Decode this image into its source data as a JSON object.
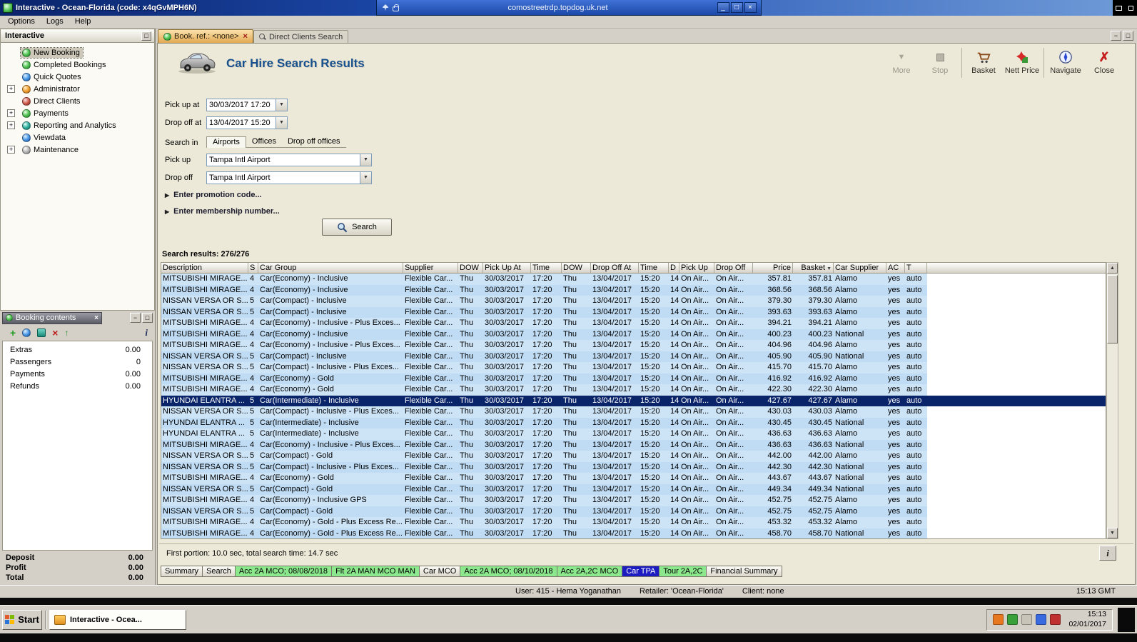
{
  "rdp": {
    "address": "comostreetrdp.topdog.uk.net"
  },
  "window": {
    "title": "Interactive - Ocean-Florida (code: x4qGvMPH6N)",
    "menu": [
      "Options",
      "Logs",
      "Help"
    ]
  },
  "sidebar": {
    "title": "Interactive",
    "items": [
      {
        "label": "New Booking",
        "selected": true
      },
      {
        "label": "Completed Bookings"
      },
      {
        "label": "Quick Quotes"
      },
      {
        "label": "Administrator",
        "expandable": true
      },
      {
        "label": "Direct Clients"
      },
      {
        "label": "Payments",
        "expandable": true
      },
      {
        "label": "Reporting and Analytics",
        "expandable": true
      },
      {
        "label": "Viewdata"
      },
      {
        "label": "Maintenance",
        "expandable": true
      }
    ]
  },
  "booking": {
    "title": "Booking contents",
    "rows": [
      {
        "label": "Extras",
        "value": "0.00"
      },
      {
        "label": "Passengers",
        "value": "0"
      },
      {
        "label": "Payments",
        "value": "0.00"
      },
      {
        "label": "Refunds",
        "value": "0.00"
      }
    ],
    "summary": [
      {
        "label": "Deposit",
        "value": "0.00"
      },
      {
        "label": "Profit",
        "value": "0.00"
      },
      {
        "label": "Total",
        "value": "0.00"
      }
    ]
  },
  "doc_tabs": [
    {
      "label": "Book. ref.: <none>",
      "active": true
    },
    {
      "label": "Direct Clients Search",
      "active": false
    }
  ],
  "page": {
    "title": "Car Hire Search Results"
  },
  "toolbar": {
    "items": [
      {
        "label": "More",
        "disabled": true
      },
      {
        "label": "Stop",
        "disabled": true
      },
      {
        "label": "Basket"
      },
      {
        "label": "Nett Price"
      },
      {
        "label": "Navigate"
      },
      {
        "label": "Close"
      }
    ]
  },
  "form": {
    "pickup_at": {
      "label": "Pick up at",
      "value": "30/03/2017 17:20"
    },
    "dropoff_at": {
      "label": "Drop off at",
      "value": "13/04/2017 15:20"
    },
    "search_in": {
      "label": "Search in",
      "tabs": [
        "Airports",
        "Offices",
        "Drop off offices"
      ],
      "active": "Airports"
    },
    "pickup": {
      "label": "Pick up",
      "value": "Tampa Intl Airport"
    },
    "dropoff": {
      "label": "Drop off",
      "value": "Tampa Intl Airport"
    },
    "promotion": "Enter promotion code...",
    "membership": "Enter membership number...",
    "search_button": "Search"
  },
  "results": {
    "count_label": "Search results: 276/276",
    "columns": [
      "Description",
      "S",
      "Car Group",
      "Supplier",
      "DOW",
      "Pick Up At",
      "Time",
      "DOW",
      "Drop Off At",
      "Time",
      "D",
      "Pick Up",
      "Drop Off",
      "Price",
      "Basket",
      "Car Supplier",
      "AC",
      "T"
    ],
    "selected_index": 11,
    "common": {
      "supplier": "Flexible Car...",
      "dow1": "Thu",
      "pickup_date": "30/03/2017",
      "pickup_time": "17:20",
      "dow2": "Thu",
      "dropoff_date": "13/04/2017",
      "dropoff_time": "15:20",
      "days": "14",
      "pickup_loc": "On Air...",
      "dropoff_loc": "On Air...",
      "ac": "yes",
      "t": "auto"
    },
    "rows": [
      {
        "description": "MITSUBISHI MIRAGE...",
        "seats": "4",
        "group": "Car(Economy) - Inclusive",
        "price": "357.81",
        "basket": "357.81",
        "car_supplier": "Alamo"
      },
      {
        "description": "MITSUBISHI MIRAGE...",
        "seats": "4",
        "group": "Car(Economy) - Inclusive",
        "price": "368.56",
        "basket": "368.56",
        "car_supplier": "Alamo"
      },
      {
        "description": "NISSAN VERSA OR S...",
        "seats": "5",
        "group": "Car(Compact) - Inclusive",
        "price": "379.30",
        "basket": "379.30",
        "car_supplier": "Alamo"
      },
      {
        "description": "NISSAN VERSA OR S...",
        "seats": "5",
        "group": "Car(Compact) - Inclusive",
        "price": "393.63",
        "basket": "393.63",
        "car_supplier": "Alamo"
      },
      {
        "description": "MITSUBISHI MIRAGE...",
        "seats": "4",
        "group": "Car(Economy) - Inclusive - Plus Exces...",
        "price": "394.21",
        "basket": "394.21",
        "car_supplier": "Alamo"
      },
      {
        "description": "MITSUBISHI MIRAGE...",
        "seats": "4",
        "group": "Car(Economy) - Inclusive",
        "price": "400.23",
        "basket": "400.23",
        "car_supplier": "National"
      },
      {
        "description": "MITSUBISHI MIRAGE...",
        "seats": "4",
        "group": "Car(Economy) - Inclusive - Plus Exces...",
        "price": "404.96",
        "basket": "404.96",
        "car_supplier": "Alamo"
      },
      {
        "description": "NISSAN VERSA OR S...",
        "seats": "5",
        "group": "Car(Compact) - Inclusive",
        "price": "405.90",
        "basket": "405.90",
        "car_supplier": "National"
      },
      {
        "description": "NISSAN VERSA OR S...",
        "seats": "5",
        "group": "Car(Compact) - Inclusive - Plus Exces...",
        "price": "415.70",
        "basket": "415.70",
        "car_supplier": "Alamo"
      },
      {
        "description": "MITSUBISHI MIRAGE...",
        "seats": "4",
        "group": "Car(Economy) - Gold",
        "price": "416.92",
        "basket": "416.92",
        "car_supplier": "Alamo"
      },
      {
        "description": "MITSUBISHI MIRAGE...",
        "seats": "4",
        "group": "Car(Economy) - Gold",
        "price": "422.30",
        "basket": "422.30",
        "car_supplier": "Alamo"
      },
      {
        "description": "HYUNDAI ELANTRA ...",
        "seats": "5",
        "group": "Car(Intermediate) - Inclusive",
        "price": "427.67",
        "basket": "427.67",
        "car_supplier": "Alamo"
      },
      {
        "description": "NISSAN VERSA OR S...",
        "seats": "5",
        "group": "Car(Compact) - Inclusive - Plus Exces...",
        "price": "430.03",
        "basket": "430.03",
        "car_supplier": "Alamo"
      },
      {
        "description": "HYUNDAI ELANTRA ...",
        "seats": "5",
        "group": "Car(Intermediate) - Inclusive",
        "price": "430.45",
        "basket": "430.45",
        "car_supplier": "National"
      },
      {
        "description": "HYUNDAI ELANTRA ...",
        "seats": "5",
        "group": "Car(Intermediate) - Inclusive",
        "price": "436.63",
        "basket": "436.63",
        "car_supplier": "Alamo"
      },
      {
        "description": "MITSUBISHI MIRAGE...",
        "seats": "4",
        "group": "Car(Economy) - Inclusive - Plus Exces...",
        "price": "436.63",
        "basket": "436.63",
        "car_supplier": "National"
      },
      {
        "description": "NISSAN VERSA OR S...",
        "seats": "5",
        "group": "Car(Compact) - Gold",
        "price": "442.00",
        "basket": "442.00",
        "car_supplier": "Alamo"
      },
      {
        "description": "NISSAN VERSA OR S...",
        "seats": "5",
        "group": "Car(Compact) - Inclusive - Plus Exces...",
        "price": "442.30",
        "basket": "442.30",
        "car_supplier": "National"
      },
      {
        "description": "MITSUBISHI MIRAGE...",
        "seats": "4",
        "group": "Car(Economy) - Gold",
        "price": "443.67",
        "basket": "443.67",
        "car_supplier": "National"
      },
      {
        "description": "NISSAN VERSA OR S...",
        "seats": "5",
        "group": "Car(Compact) - Gold",
        "price": "449.34",
        "basket": "449.34",
        "car_supplier": "National"
      },
      {
        "description": "MITSUBISHI MIRAGE...",
        "seats": "4",
        "group": "Car(Economy) - Inclusive GPS",
        "price": "452.75",
        "basket": "452.75",
        "car_supplier": "Alamo"
      },
      {
        "description": "NISSAN VERSA OR S...",
        "seats": "5",
        "group": "Car(Compact) - Gold",
        "price": "452.75",
        "basket": "452.75",
        "car_supplier": "Alamo"
      },
      {
        "description": "MITSUBISHI MIRAGE...",
        "seats": "4",
        "group": "Car(Economy) - Gold - Plus Excess Re...",
        "price": "453.32",
        "basket": "453.32",
        "car_supplier": "Alamo"
      },
      {
        "description": "MITSUBISHI MIRAGE...",
        "seats": "4",
        "group": "Car(Economy) - Gold - Plus Excess Re...",
        "price": "458.70",
        "basket": "458.70",
        "car_supplier": "National"
      }
    ]
  },
  "status_line": "First portion: 10.0 sec, total search time: 14.7 sec",
  "bottom_tabs": [
    {
      "label": "Summary",
      "style": "plain"
    },
    {
      "label": "Search",
      "style": "plain"
    },
    {
      "label": "Acc 2A MCO; 08/08/2018",
      "style": "green"
    },
    {
      "label": "Flt 2A MAN MCO MAN",
      "style": "green"
    },
    {
      "label": "Car MCO",
      "style": "plain"
    },
    {
      "label": "Acc 2A MCO; 08/10/2018",
      "style": "green"
    },
    {
      "label": "Acc 2A,2C MCO",
      "style": "green"
    },
    {
      "label": "Car TPA",
      "style": "blue",
      "active": true
    },
    {
      "label": "Tour 2A,2C",
      "style": "green"
    },
    {
      "label": "Financial Summary",
      "style": "plain"
    }
  ],
  "statusbar": {
    "user": "User: 415 - Hema Yoganathan",
    "retailer": "Retailer: 'Ocean-Florida'",
    "client": "Client: none",
    "time": "15:13 GMT"
  },
  "taskbar": {
    "start": "Start",
    "task": "Interactive - Ocea...",
    "clock_time": "15:13",
    "clock_date": "02/01/2017"
  }
}
